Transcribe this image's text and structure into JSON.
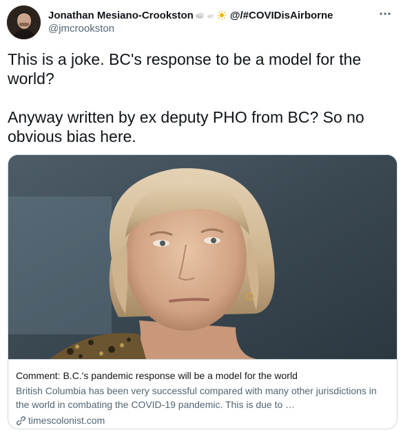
{
  "tweet": {
    "display_name": "Jonathan Mesiano-Crookston",
    "name_suffix": "@/#COVIDisAirborne",
    "name_emojis": [
      "cloud-emoji",
      "sun-emoji"
    ],
    "handle": "@jmcrookston",
    "text": "This is a joke. BC's response to be a model for the world?\n\nAnyway written by ex deputy PHO from BC? So no obvious bias here."
  },
  "card": {
    "image_alt": "Photo of a woman with short blonde hair",
    "title": "Comment: B.C.'s pandemic response will be a model for the world",
    "description": "British Columbia has been very successful compared with many other jurisdictions in the world in combating the COVID-19 pandemic. This is due to …",
    "domain": "timescolonist.com"
  },
  "icons": {
    "more": "more-horizontal-icon",
    "link": "link-icon"
  },
  "colors": {
    "text_primary": "#0f1419",
    "text_secondary": "#536471",
    "border": "#cfd9de"
  }
}
